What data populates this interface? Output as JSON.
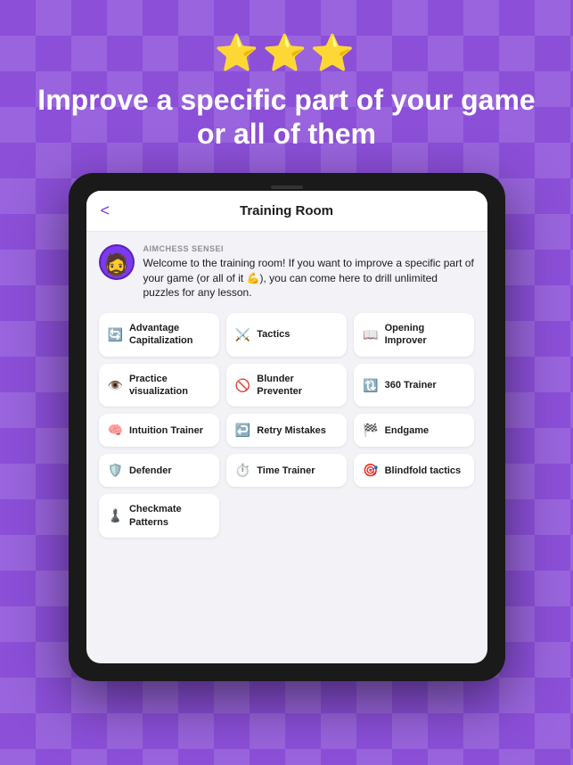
{
  "background": {
    "color": "#8B4FD8"
  },
  "stars": "⭐⭐⭐",
  "headline": "Improve a specific part of your game or all of them",
  "tablet": {
    "screen": {
      "header": {
        "back_label": "<",
        "title": "Training Room"
      },
      "sensei": {
        "label": "AIMCHESS SENSEI",
        "message": "Welcome to the training room! If you want to improve a specific part of your game (or all of it 💪), you can come here to drill unlimited puzzles for any lesson."
      },
      "training_items": [
        {
          "id": "advantage-cap",
          "icon": "🔄",
          "label": "Advantage Capitalization"
        },
        {
          "id": "tactics",
          "icon": "⚔️",
          "label": "Tactics"
        },
        {
          "id": "opening-improver",
          "icon": "📖",
          "label": "Opening Improver"
        },
        {
          "id": "practice-viz",
          "icon": "👁️",
          "label": "Practice visualization"
        },
        {
          "id": "blunder-preventer",
          "icon": "🚫",
          "label": "Blunder Preventer"
        },
        {
          "id": "360-trainer",
          "icon": "🔃",
          "label": "360 Trainer"
        },
        {
          "id": "intuition-trainer",
          "icon": "🧠",
          "label": "Intuition Trainer"
        },
        {
          "id": "retry-mistakes",
          "icon": "↩️",
          "label": "Retry Mistakes"
        },
        {
          "id": "endgame",
          "icon": "🏁",
          "label": "Endgame"
        },
        {
          "id": "defender",
          "icon": "🛡️",
          "label": "Defender"
        },
        {
          "id": "time-trainer",
          "icon": "⏱️",
          "label": "Time Trainer"
        },
        {
          "id": "blindfold-tactics",
          "icon": "🎯",
          "label": "Blindfold tactics"
        },
        {
          "id": "checkmate-patterns",
          "icon": "♟️",
          "label": "Checkmate Patterns"
        }
      ]
    }
  }
}
